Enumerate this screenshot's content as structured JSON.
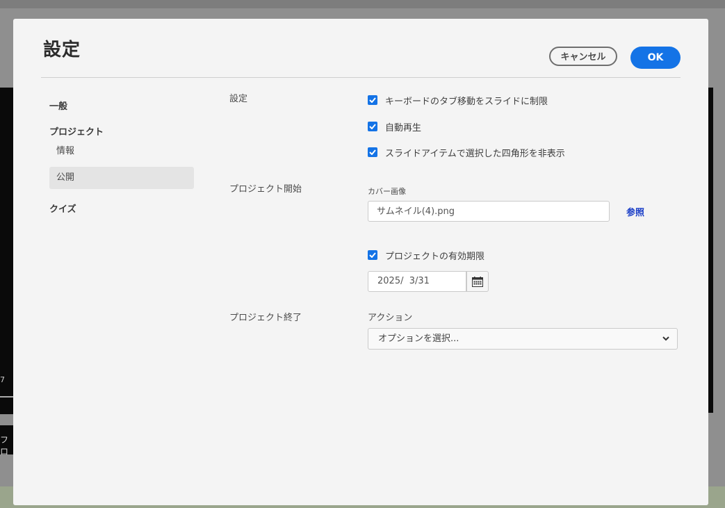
{
  "background": {
    "left_number": "7",
    "bottom_fragment": "フロ"
  },
  "dialog": {
    "title": "設定",
    "cancel_label": "キャンセル",
    "ok_label": "OK"
  },
  "sidebar": {
    "general": "一般",
    "project": "プロジェクト",
    "items": [
      {
        "label": "情報",
        "selected": false
      },
      {
        "label": "公開",
        "selected": true
      }
    ],
    "quiz": "クイズ"
  },
  "settings": {
    "label": "設定",
    "options": [
      {
        "label": "キーボードのタブ移動をスライドに制限",
        "checked": true
      },
      {
        "label": "自動再生",
        "checked": true
      },
      {
        "label": "スライドアイテムで選択した四角形を非表示",
        "checked": true
      }
    ]
  },
  "project_start": {
    "label": "プロジェクト開始",
    "cover_label": "カバー画像",
    "cover_value": "サムネイル(4).png",
    "browse_label": "参照",
    "expiry_label": "プロジェクトの有効期限",
    "expiry_checked": true,
    "expiry_date": "2025/  3/31"
  },
  "project_end": {
    "label": "プロジェクト終了",
    "action_label": "アクション",
    "action_placeholder": "オプションを選択..."
  },
  "colors": {
    "accent": "#1473e6",
    "link": "#1a3ec7",
    "dialog_bg": "#f4f4f4"
  }
}
